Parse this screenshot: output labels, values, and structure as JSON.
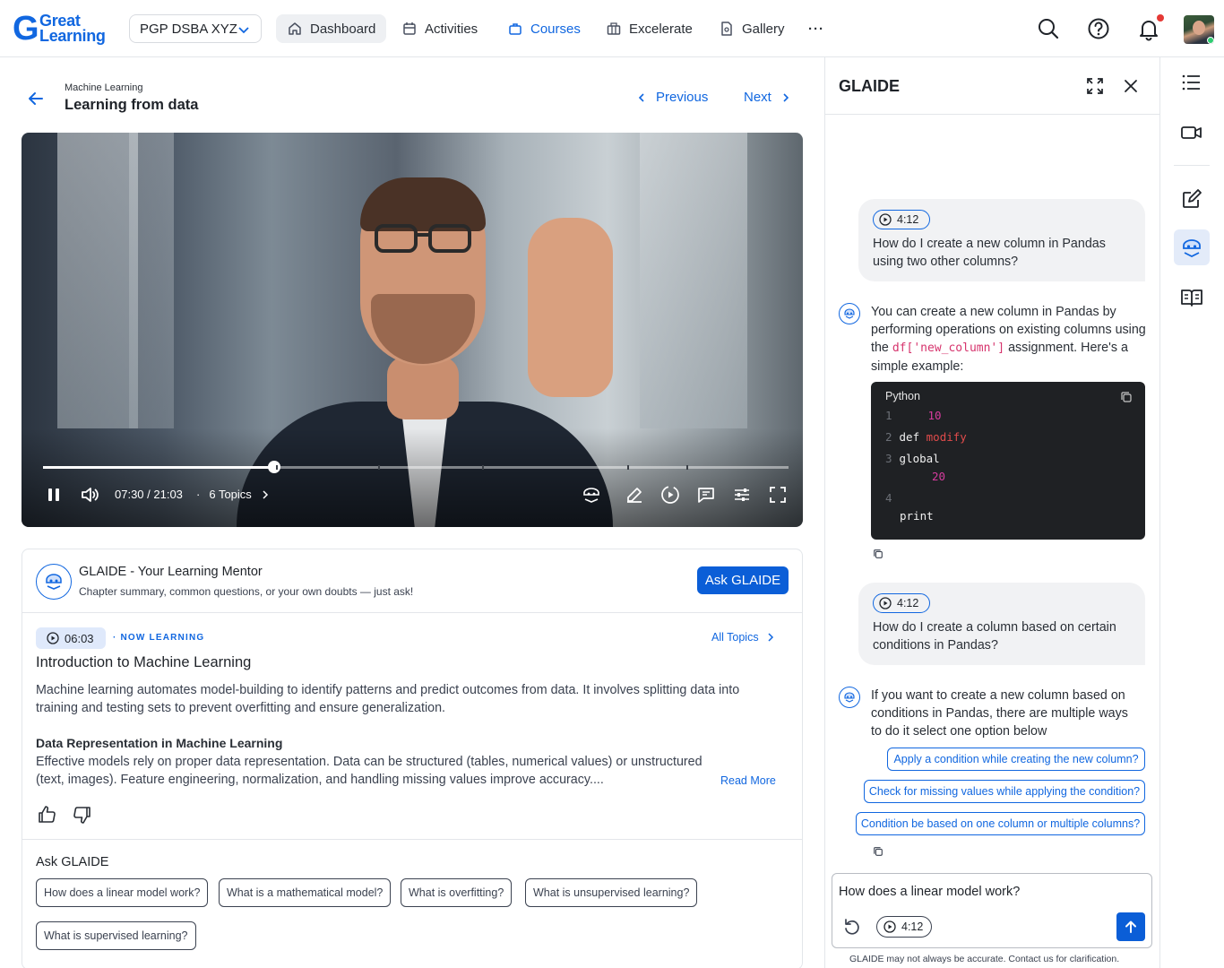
{
  "brand": {
    "line1": "Great",
    "line2": "Learning"
  },
  "program_selector": {
    "label": "PGP DSBA XYZ"
  },
  "nav": {
    "dashboard": "Dashboard",
    "activities": "Activities",
    "courses": "Courses",
    "excelerate": "Excelerate",
    "gallery": "Gallery",
    "more": "···"
  },
  "colors": {
    "accent": "#1167e0",
    "primary_button": "#0b5ed7",
    "notification": "#e53935",
    "code_bg": "#1f2124",
    "code_keyword": "#e04b4b",
    "code_number": "#d63c9e"
  },
  "breadcrumb": {
    "section": "Machine Learning",
    "title": "Learning from data"
  },
  "pager": {
    "previous": "Previous",
    "next": "Next"
  },
  "video": {
    "time": "07:30 / 21:03",
    "topics": "6 Topics",
    "progress_fraction": 0.31
  },
  "mentor": {
    "title": "GLAIDE - Your Learning Mentor",
    "subtitle": "Chapter summary, common questions, or your own doubts — just ask!",
    "ask_button": "Ask GLAIDE"
  },
  "topic": {
    "timestamp": "06:03",
    "status": "· NOW LEARNING",
    "all_topics": "All Topics",
    "title": "Introduction to Machine Learning",
    "description": "Machine learning automates model-building to identify patterns and predict outcomes from data. It involves splitting data into training and testing sets to prevent overfitting and ensure generalization.",
    "sub_heading": "Data Representation in Machine Learning",
    "sub_description": "Effective models rely on proper data representation. Data can be structured (tables, numerical values) or unstructured (text, images). Feature engineering, normalization, and handling missing values improve accuracy....",
    "read_more": "Read More"
  },
  "ask_glaide": {
    "label": "Ask GLAIDE",
    "questions": [
      "How does a linear model work?",
      "What is a mathematical model?",
      "What is overfitting?",
      "What is unsupervised learning?",
      "What is supervised learning?"
    ]
  },
  "panel": {
    "title": "GLAIDE",
    "messages": [
      {
        "timestamp": "4:12",
        "text": "How do I create a new column in Pandas using two other columns?"
      },
      {
        "text_before": "You can create a new column in Pandas by performing operations on existing columns using the ",
        "code": "df['new_column']",
        "text_after": " assignment. Here's a simple example:"
      },
      {
        "timestamp": "4:12",
        "text": "How do I create a column based on certain conditions in Pandas?"
      },
      {
        "text": "If you want to create a new column based on conditions in Pandas, there are multiple ways to do it select one option below"
      }
    ],
    "code_block": {
      "language": "Python",
      "lines": [
        {
          "n": "1",
          "a": "",
          "b": "10"
        },
        {
          "n": "2",
          "a": "def ",
          "b": "modify"
        },
        {
          "n": "3",
          "a": "global",
          "b": ""
        },
        {
          "n": "",
          "a": "",
          "b": "20"
        },
        {
          "n": "4",
          "a": "",
          "b": ""
        },
        {
          "n": "",
          "a": "print",
          "b": ""
        }
      ]
    },
    "options": [
      "Apply a condition while creating the new column?",
      "Check for missing values while applying the condition?",
      "Condition be based on one column or multiple columns?"
    ],
    "input": {
      "value": "How does a linear model work?",
      "timestamp": "4:12"
    },
    "disclaimer": "GLAIDE may not always be accurate. Contact us for clarification."
  }
}
